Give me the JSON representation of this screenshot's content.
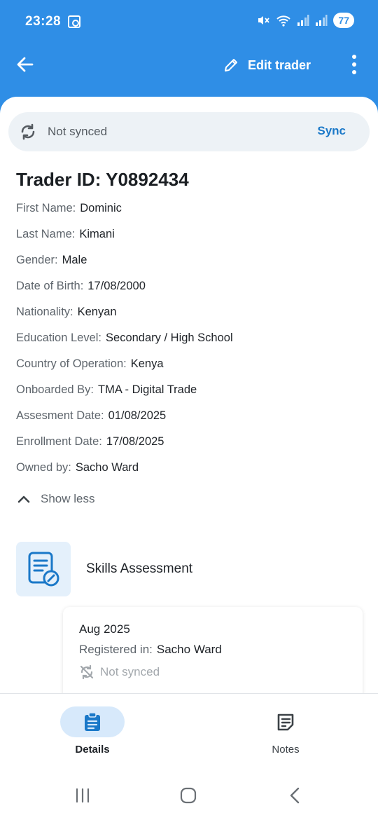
{
  "status_bar": {
    "time": "23:28",
    "battery": "77"
  },
  "app_bar": {
    "edit_label": "Edit trader"
  },
  "sync": {
    "status": "Not synced",
    "action": "Sync"
  },
  "trader": {
    "title": "Trader ID: Y0892434",
    "fields": [
      {
        "label": "First Name:",
        "value": "Dominic"
      },
      {
        "label": "Last Name:",
        "value": "Kimani"
      },
      {
        "label": "Gender:",
        "value": "Male"
      },
      {
        "label": "Date of Birth:",
        "value": "17/08/2000"
      },
      {
        "label": "Nationality:",
        "value": "Kenyan"
      },
      {
        "label": "Education Level:",
        "value": "Secondary / High School"
      },
      {
        "label": "Country of Operation:",
        "value": "Kenya"
      },
      {
        "label": "Onboarded By:",
        "value": "TMA - Digital Trade"
      },
      {
        "label": "Assesment Date:",
        "value": "01/08/2025"
      },
      {
        "label": "Enrollment Date:",
        "value": "17/08/2025"
      },
      {
        "label": "Owned by:",
        "value": "Sacho Ward"
      }
    ],
    "show_less": "Show less"
  },
  "skills": {
    "title": "Skills Assessment",
    "card": {
      "date": "Aug 2025",
      "registered_label": "Registered in:",
      "registered_value": "Sacho Ward",
      "sync_status": "Not synced"
    }
  },
  "bottom_nav": {
    "details": "Details",
    "notes": "Notes"
  },
  "colors": {
    "primary": "#2f8ee6",
    "accent": "#1a78c8",
    "nav_active_bg": "#d7e9fb"
  }
}
